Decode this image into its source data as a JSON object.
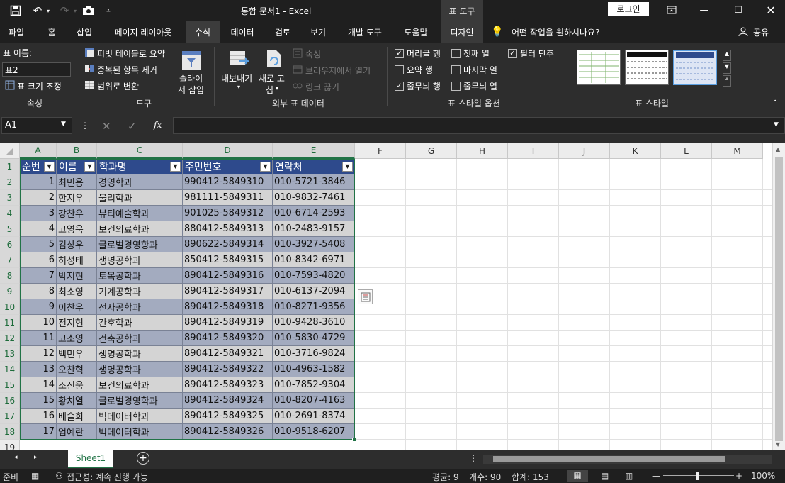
{
  "titlebar": {
    "doc_title": "통합 문서1  -  Excel",
    "context_tab": "표 도구",
    "login_label": "로그인"
  },
  "tabs": [
    "파일",
    "홈",
    "삽입",
    "페이지 레이아웃",
    "수식",
    "데이터",
    "검토",
    "보기",
    "개발 도구",
    "도움말",
    "디자인"
  ],
  "tell_me": "어떤 작업을 원하시나요?",
  "share": "공유",
  "ribbon": {
    "properties": {
      "table_name_label": "표 이름:",
      "table_name_value": "표2",
      "resize_label": "표 크기 조정",
      "group_label": "속성"
    },
    "tools": {
      "pivot": "피벗 테이블로 요약",
      "dedupe": "중복된 항목 제거",
      "convert": "범위로 변환",
      "slicer_1": "슬라이",
      "slicer_2": "서 삽입",
      "group_label": "도구"
    },
    "external": {
      "export": "내보내기",
      "refresh_1": "새로 고",
      "refresh_2": "침",
      "properties": "속성",
      "open_browser": "브라우저에서 열기",
      "unlink": "링크 끊기",
      "group_label": "외부 표 데이터"
    },
    "style_options": {
      "header_row": "머리글 행",
      "total_row": "요약 행",
      "banded_rows": "줄무늬 행",
      "first_col": "첫째 열",
      "last_col": "마지막 열",
      "banded_cols": "줄무늬 열",
      "filter_btn": "필터 단추",
      "group_label": "표 스타일 옵션",
      "checked": {
        "header_row": true,
        "total_row": false,
        "banded_rows": true,
        "first_col": false,
        "last_col": false,
        "banded_cols": false,
        "filter_btn": true
      }
    },
    "table_styles": {
      "group_label": "표 스타일"
    }
  },
  "formula_bar": {
    "name_box": "A1",
    "formula": ""
  },
  "columns": [
    "A",
    "B",
    "C",
    "D",
    "E",
    "F",
    "G",
    "H",
    "I",
    "J",
    "K",
    "L",
    "M"
  ],
  "table": {
    "headers": [
      "순번",
      "이름",
      "학과명",
      "주민번호",
      "연락처"
    ],
    "rows": [
      [
        "1",
        "최민용",
        "경영학과",
        "990412-5849310",
        "010-5721-3846"
      ],
      [
        "2",
        "한지우",
        "물리학과",
        "981111-5849311",
        "010-9832-7461"
      ],
      [
        "3",
        "강찬우",
        "뷰티예술학과",
        "901025-5849312",
        "010-6714-2593"
      ],
      [
        "4",
        "고영욱",
        "보건의료학과",
        "880412-5849313",
        "010-2483-9157"
      ],
      [
        "5",
        "김상우",
        "글로벌경영항과",
        "890622-5849314",
        "010-3927-5408"
      ],
      [
        "6",
        "허성태",
        "생명공학과",
        "850412-5849315",
        "010-8342-6971"
      ],
      [
        "7",
        "박지현",
        "토목공학과",
        "890412-5849316",
        "010-7593-4820"
      ],
      [
        "8",
        "최소영",
        "기계공학과",
        "890412-5849317",
        "010-6137-2094"
      ],
      [
        "9",
        "이찬우",
        "전자공학과",
        "890412-5849318",
        "010-8271-9356"
      ],
      [
        "10",
        "전지현",
        "간호학과",
        "890412-5849319",
        "010-9428-3610"
      ],
      [
        "11",
        "고소영",
        "건축공학과",
        "890412-5849320",
        "010-5830-4729"
      ],
      [
        "12",
        "백민우",
        "생명공학과",
        "890412-5849321",
        "010-3716-9824"
      ],
      [
        "13",
        "오찬혁",
        "생명공학과",
        "890412-5849322",
        "010-4963-1582"
      ],
      [
        "14",
        "조진웅",
        "보건의료학과",
        "890412-5849323",
        "010-7852-9304"
      ],
      [
        "15",
        "황치열",
        "글로벌경영학과",
        "890412-5849324",
        "010-8207-4163"
      ],
      [
        "16",
        "배슬희",
        "빅데이터학과",
        "890412-5849325",
        "010-2691-8374"
      ],
      [
        "17",
        "엄예란",
        "빅데이터학과",
        "890412-5849326",
        "010-9518-6207"
      ]
    ]
  },
  "row_numbers": [
    "1",
    "2",
    "3",
    "4",
    "5",
    "6",
    "7",
    "8",
    "9",
    "10",
    "11",
    "12",
    "13",
    "14",
    "15",
    "16",
    "17",
    "18",
    "19"
  ],
  "sheets": {
    "active": "Sheet1"
  },
  "status": {
    "ready": "준비",
    "accessibility": "접근성: 계속 진행 가능",
    "average": "평균: 9",
    "count": "개수: 90",
    "sum": "합계: 153",
    "zoom": "100%"
  },
  "colors": {
    "header_blue": "#2e4a8c",
    "band_dark": "#a3abbf",
    "band_light": "#d4d4d4",
    "accent_green": "#217346"
  }
}
